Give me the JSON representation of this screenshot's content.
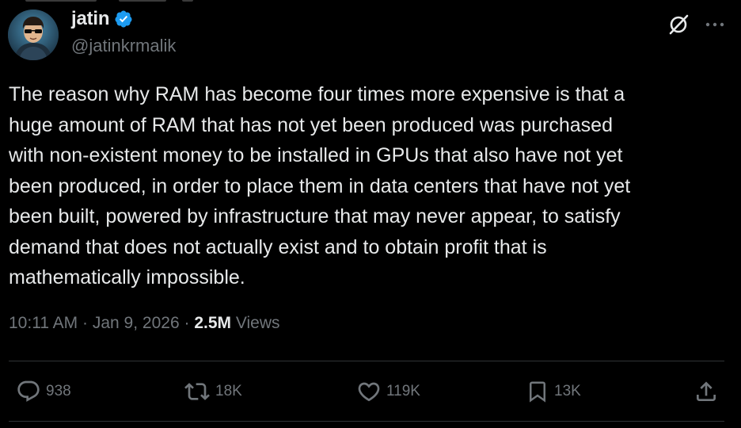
{
  "tweet": {
    "author": {
      "name": "jatin",
      "handle": "@jatinkrmalik",
      "verified": true
    },
    "text": "The reason why RAM has become four times more expensive is that a\nhuge amount of RAM that has not yet been produced was purchased\nwith non-existent money to be installed in GPUs that also have not yet\nbeen produced, in order to place them in data centers that have not yet\nbeen built, powered by infrastructure that may never appear, to satisfy\ndemand that does not actually exist and to obtain profit that is\nmathematically impossible.",
    "time": "10:11 AM",
    "separator": "·",
    "date": "Jan 9, 2026",
    "views_count": "2.5M",
    "views_label": "Views"
  },
  "actions": {
    "replies": "938",
    "reposts": "18K",
    "likes": "119K",
    "bookmarks": "13K"
  },
  "icons": {
    "verified": "verified-badge-icon",
    "grok": "grok-icon",
    "more": "more-icon",
    "reply": "reply-icon",
    "repost": "repost-icon",
    "like": "like-icon",
    "bookmark": "bookmark-icon",
    "share": "share-icon"
  },
  "colors": {
    "background": "#000000",
    "text": "#e7e9ea",
    "secondary": "#71767b",
    "verified": "#1d9bf0",
    "divider": "#2f3336"
  }
}
